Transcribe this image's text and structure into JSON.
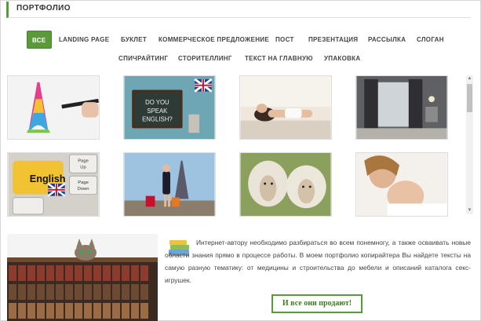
{
  "header": {
    "title": "ПОРТФОЛИО"
  },
  "filters": {
    "row1": [
      {
        "label": "ВСЕ",
        "active": true
      },
      {
        "label": "LANDING PAGE"
      },
      {
        "label": "БУКЛЕТ"
      },
      {
        "label": "КОММЕРЧЕСКОЕ ПРЕДЛОЖЕНИЕ"
      },
      {
        "label": "ПОСТ"
      },
      {
        "label": "ПРЕЗЕНТАЦИЯ"
      },
      {
        "label": "РАССЫЛКА"
      },
      {
        "label": "СЛОГАН"
      }
    ],
    "row2": [
      {
        "label": "СПИЧРАЙТИНГ"
      },
      {
        "label": "СТОРИТЕЛЛИНГ"
      },
      {
        "label": "ТЕКСТ НА ГЛАВНУЮ"
      },
      {
        "label": "УПАКОВКА"
      }
    ]
  },
  "portfolio": {
    "thumbnails": [
      {
        "icon": "eiffel-tower-3d-pen-image"
      },
      {
        "icon": "do-you-speak-english-chalkboard-image",
        "chalk_text": "DO YOU SPEAK ENGLISH?"
      },
      {
        "icon": "woman-relaxing-image"
      },
      {
        "icon": "interior-curtains-image"
      },
      {
        "icon": "english-keyboard-image",
        "key_text": "English",
        "key_up": "Page Up",
        "key_down": "Page Down"
      },
      {
        "icon": "woman-shopping-paris-image"
      },
      {
        "icon": "sheep-image"
      },
      {
        "icon": "mother-and-baby-image"
      }
    ]
  },
  "description": {
    "text": "Интернет-автору необходимо разбираться во всем понемногу, а также осваивать новые области знания прямо в процессе работы. В моем портфолио копирайтера Вы найдете тексты на самую разную тематику: от медицины и строительства до мебели и описаний каталога секс-игрушек.",
    "icon": "books-icon",
    "image": "cat-on-bookshelf-image"
  },
  "cta": {
    "label": "И все они продают!"
  },
  "colors": {
    "accent": "#5b9a3a"
  }
}
